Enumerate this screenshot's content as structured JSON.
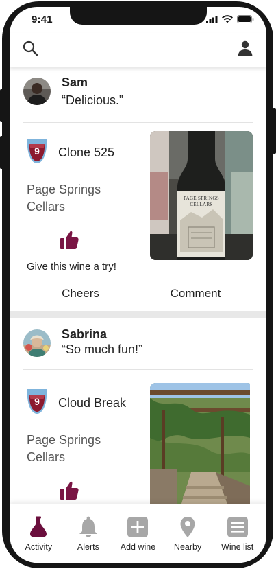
{
  "status_bar": {
    "time": "9:41"
  },
  "header": {
    "search_icon": "search-icon",
    "profile_icon": "person-icon"
  },
  "posts": [
    {
      "user": "Sam",
      "comment": "“Delicious.”",
      "rating": "9",
      "wine": "Clone 525",
      "winery": "Page Springs Cellars",
      "recommendation": "Give this wine a try!",
      "photo_label": "PAGE SPRINGS CELLARS"
    },
    {
      "user": "Sabrina",
      "comment": "“So much fun!”",
      "rating": "9",
      "wine": "Cloud Break",
      "winery": "Page Springs Cellars"
    }
  ],
  "actions": {
    "cheers": "Cheers",
    "comment": "Comment"
  },
  "tabs": [
    {
      "label": "Activity",
      "icon": "decanter-icon",
      "active": true
    },
    {
      "label": "Alerts",
      "icon": "bell-icon"
    },
    {
      "label": "Add wine",
      "icon": "plus-icon"
    },
    {
      "label": "Nearby",
      "icon": "location-pin-icon"
    },
    {
      "label": "Wine list",
      "icon": "list-icon"
    }
  ],
  "colors": {
    "accent": "#6b0f3d",
    "wine_red": "#8c1a2f",
    "glass_outline": "#7fb4dc",
    "icon_gray": "#a7a7a7"
  }
}
